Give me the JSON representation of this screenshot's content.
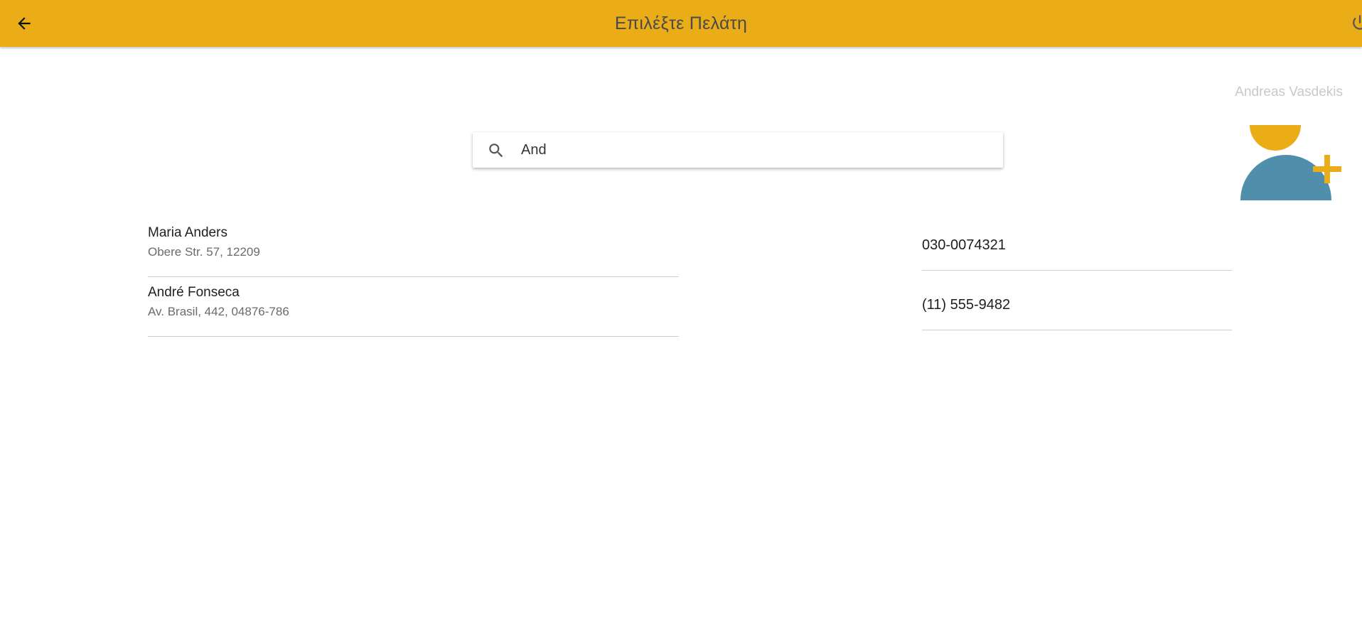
{
  "header": {
    "title": "Επιλέξτε Πελάτη",
    "background_color": "#ebad17",
    "back_icon": "arrow-left-icon",
    "power_icon": "power-icon"
  },
  "user": {
    "name": "Andreas Vasdekis"
  },
  "add_customer": {
    "icon": "add-user-icon",
    "head_color": "#ebad17",
    "body_color": "#4f8fab",
    "plus_color": "#ebad17"
  },
  "search": {
    "value": "And",
    "icon": "search-icon"
  },
  "customers": [
    {
      "name": "Maria Anders",
      "address": "Obere Str. 57, 12209",
      "phone": "030-0074321"
    },
    {
      "name": "André Fonseca",
      "address": "Av. Brasil, 442, 04876-786",
      "phone": "(11) 555-9482"
    }
  ]
}
